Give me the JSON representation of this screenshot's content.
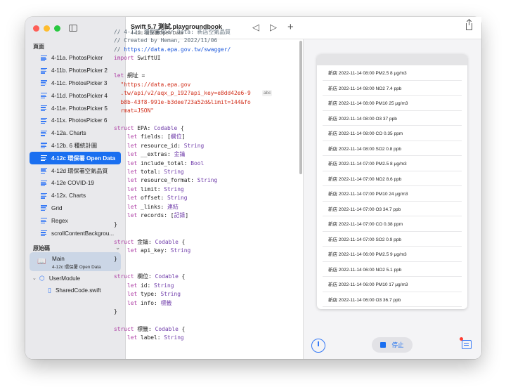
{
  "window": {
    "title": "Swift 5.7 測試.playgroundbook",
    "subtitle": "4-12c 環保署Open Data"
  },
  "toolbar": {
    "back_icon": "◁",
    "forward_icon": "▷",
    "add_icon": "+"
  },
  "sidebar": {
    "pages_header": "頁面",
    "pages": [
      {
        "label": "4-11a. PhotosPicker"
      },
      {
        "label": "4-11b. PhotosPicker 2"
      },
      {
        "label": "4-11c. PhotosPicker 3"
      },
      {
        "label": "4-11d. PhotosPicker 4"
      },
      {
        "label": "4-11e. PhotosPicker 5"
      },
      {
        "label": "4-11x. PhotosPicker 6"
      },
      {
        "label": "4-12a. Charts"
      },
      {
        "label": "4-12b. 6 種統計圖"
      },
      {
        "label": "4-12c 環保署 Open Data",
        "selected": true
      },
      {
        "label": "4-12d 環保署空氣品質"
      },
      {
        "label": "4-12e COVID-19"
      },
      {
        "label": "4-12x. Charts"
      },
      {
        "label": "Grid"
      },
      {
        "label": "Regex"
      },
      {
        "label": "scrollContentBackgrou..."
      }
    ],
    "source_header": "原始碼",
    "source_main": {
      "title": "Main",
      "subtitle": "4-12c 環保署 Open Data"
    },
    "module": "UserModule",
    "shared_file": "SharedCode.swift"
  },
  "code": {
    "abc_badge": "abc",
    "lines": [
      [
        {
          "c": "cm",
          "t": "// 4-12c 環保署Open Data: 新店空氣品質"
        }
      ],
      [
        {
          "c": "cm",
          "t": "// Created by Heman, 2022/11/06"
        }
      ],
      [
        {
          "c": "cm",
          "t": "// "
        },
        {
          "c": "lnk",
          "t": "https://data.epa.gov.tw/swagger/"
        }
      ],
      [
        {
          "c": "kw",
          "t": "import"
        },
        {
          "c": "",
          "t": " SwiftUI"
        }
      ],
      [
        {
          "c": "",
          "t": ""
        }
      ],
      [
        {
          "c": "kw",
          "t": "let"
        },
        {
          "c": "",
          "t": " 網址 ="
        }
      ],
      [
        {
          "c": "str",
          "t": "  \"https://data.epa.gov"
        }
      ],
      [
        {
          "c": "str",
          "t": "  .tw/api/v2/aqx_p_192?api_key=e8dd42e6-9"
        }
      ],
      [
        {
          "c": "str",
          "t": "  b8b-43f8-991e-b3dee723a52d&limit=144&fo"
        }
      ],
      [
        {
          "c": "str",
          "t": "  rmat=JSON\""
        }
      ],
      [
        {
          "c": "",
          "t": ""
        }
      ],
      [
        {
          "c": "kw",
          "t": "struct"
        },
        {
          "c": "",
          "t": " EPA: "
        },
        {
          "c": "ty",
          "t": "Codable"
        },
        {
          "c": "",
          "t": " {"
        }
      ],
      [
        {
          "c": "",
          "t": "    "
        },
        {
          "c": "kw",
          "t": "let"
        },
        {
          "c": "",
          "t": " fields: ["
        },
        {
          "c": "ty",
          "t": "欄位"
        },
        {
          "c": "",
          "t": "]"
        }
      ],
      [
        {
          "c": "",
          "t": "    "
        },
        {
          "c": "kw",
          "t": "let"
        },
        {
          "c": "",
          "t": " resource_id: "
        },
        {
          "c": "ty",
          "t": "String"
        }
      ],
      [
        {
          "c": "",
          "t": "    "
        },
        {
          "c": "kw",
          "t": "let"
        },
        {
          "c": "",
          "t": " __extras: "
        },
        {
          "c": "ty",
          "t": "金鑰"
        }
      ],
      [
        {
          "c": "",
          "t": "    "
        },
        {
          "c": "kw",
          "t": "let"
        },
        {
          "c": "",
          "t": " include_total: "
        },
        {
          "c": "ty",
          "t": "Bool"
        }
      ],
      [
        {
          "c": "",
          "t": "    "
        },
        {
          "c": "kw",
          "t": "let"
        },
        {
          "c": "",
          "t": " total: "
        },
        {
          "c": "ty",
          "t": "String"
        }
      ],
      [
        {
          "c": "",
          "t": "    "
        },
        {
          "c": "kw",
          "t": "let"
        },
        {
          "c": "",
          "t": " resource_format: "
        },
        {
          "c": "ty",
          "t": "String"
        }
      ],
      [
        {
          "c": "",
          "t": "    "
        },
        {
          "c": "kw",
          "t": "let"
        },
        {
          "c": "",
          "t": " limit: "
        },
        {
          "c": "ty",
          "t": "String"
        }
      ],
      [
        {
          "c": "",
          "t": "    "
        },
        {
          "c": "kw",
          "t": "let"
        },
        {
          "c": "",
          "t": " offset: "
        },
        {
          "c": "ty",
          "t": "String"
        }
      ],
      [
        {
          "c": "",
          "t": "    "
        },
        {
          "c": "kw",
          "t": "let"
        },
        {
          "c": "",
          "t": " _links: "
        },
        {
          "c": "ty",
          "t": "連結"
        }
      ],
      [
        {
          "c": "",
          "t": "    "
        },
        {
          "c": "kw",
          "t": "let"
        },
        {
          "c": "",
          "t": " records: ["
        },
        {
          "c": "ty",
          "t": "記錄"
        },
        {
          "c": "",
          "t": "]"
        }
      ],
      [
        {
          "c": "",
          "t": "}"
        }
      ],
      [
        {
          "c": "",
          "t": ""
        }
      ],
      [
        {
          "c": "kw",
          "t": "struct"
        },
        {
          "c": "",
          "t": " 金鑰: "
        },
        {
          "c": "ty",
          "t": "Codable"
        },
        {
          "c": "",
          "t": " {"
        }
      ],
      [
        {
          "c": "",
          "t": "    "
        },
        {
          "c": "kw",
          "t": "let"
        },
        {
          "c": "",
          "t": " api_key: "
        },
        {
          "c": "ty",
          "t": "String"
        }
      ],
      [
        {
          "c": "",
          "t": "}"
        }
      ],
      [
        {
          "c": "",
          "t": ""
        }
      ],
      [
        {
          "c": "kw",
          "t": "struct"
        },
        {
          "c": "",
          "t": " 欄位: "
        },
        {
          "c": "ty",
          "t": "Codable"
        },
        {
          "c": "",
          "t": " {"
        }
      ],
      [
        {
          "c": "",
          "t": "    "
        },
        {
          "c": "kw",
          "t": "let"
        },
        {
          "c": "",
          "t": " id: "
        },
        {
          "c": "ty",
          "t": "String"
        }
      ],
      [
        {
          "c": "",
          "t": "    "
        },
        {
          "c": "kw",
          "t": "let"
        },
        {
          "c": "",
          "t": " type: "
        },
        {
          "c": "ty",
          "t": "String"
        }
      ],
      [
        {
          "c": "",
          "t": "    "
        },
        {
          "c": "kw",
          "t": "let"
        },
        {
          "c": "",
          "t": " info: "
        },
        {
          "c": "ty",
          "t": "標籤"
        }
      ],
      [
        {
          "c": "",
          "t": "}"
        }
      ],
      [
        {
          "c": "",
          "t": ""
        }
      ],
      [
        {
          "c": "kw",
          "t": "struct"
        },
        {
          "c": "",
          "t": " 標籤: "
        },
        {
          "c": "ty",
          "t": "Codable"
        },
        {
          "c": "",
          "t": " {"
        }
      ],
      [
        {
          "c": "",
          "t": "    "
        },
        {
          "c": "kw",
          "t": "let"
        },
        {
          "c": "",
          "t": " label: "
        },
        {
          "c": "ty",
          "t": "String"
        }
      ]
    ]
  },
  "live_view": {
    "rows": [
      "新店 2022-11-14 08:00 PM2.5 8 μg/m3",
      "新店 2022-11-14 08:00 NO2 7.4 ppb",
      "新店 2022-11-14 08:00 PM10 25 μg/m3",
      "新店 2022-11-14 08:00 O3 37 ppb",
      "新店 2022-11-14 08:00 CO 0.35 ppm",
      "新店 2022-11-14 08:00 SO2 0.8 ppb",
      "新店 2022-11-14 07:00 PM2.5 8 μg/m3",
      "新店 2022-11-14 07:00 NO2 8.6 ppb",
      "新店 2022-11-14 07:00 PM10 24 μg/m3",
      "新店 2022-11-14 07:00 O3 34.7 ppb",
      "新店 2022-11-14 07:00 CO 0.38 ppm",
      "新店 2022-11-14 07:00 SO2 0.9 ppb",
      "新店 2022-11-14 06:00 PM2.5 9 μg/m3",
      "新店 2022-11-14 06:00 NO2 5.1 ppb",
      "新店 2022-11-14 06:00 PM10 17 μg/m3",
      "新店 2022-11-14 06:00 O3 36.7 ppb"
    ],
    "stop_label": "停止"
  }
}
